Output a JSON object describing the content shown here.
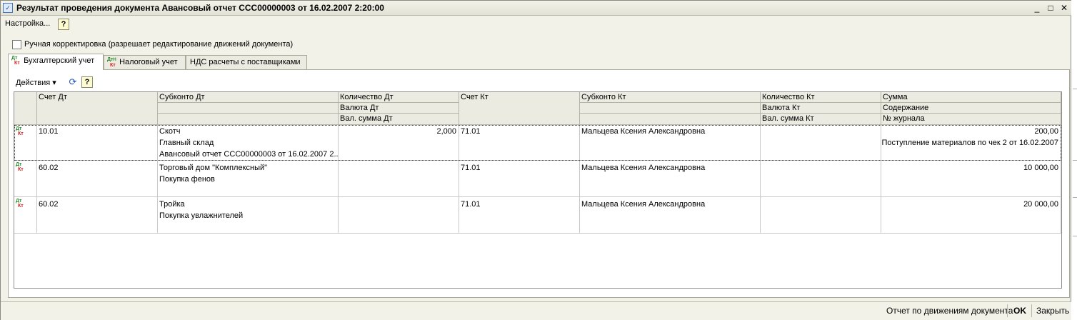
{
  "window": {
    "title": "Результат проведения документа Авансовый отчет ССС00000003 от 16.02.2007 2:20:00",
    "icon": "document-icon",
    "minimize": "_",
    "maximize": "□",
    "close": "✕"
  },
  "menu": {
    "settings": "Настройка...",
    "help": "?"
  },
  "manual_correction": {
    "label": "Ручная корректировка (разрешает редактирование движений документа)",
    "checked": false
  },
  "tabs": [
    {
      "label": "Бухгалтерский учет",
      "icon": "dt-kt-icon",
      "active": true
    },
    {
      "label": "Налоговый учет",
      "icon": "dt-kt-tax-icon",
      "active": false
    },
    {
      "label": "НДС расчеты с поставщиками",
      "icon": "",
      "active": false
    }
  ],
  "icon_text": {
    "dt": "Дт",
    "kt": "Кт",
    "n": "Н"
  },
  "toolbar": {
    "actions": "Действия ▾",
    "refresh": "⟳",
    "help": "?"
  },
  "table": {
    "headers": {
      "schet_dt": "Счет Дт",
      "subkonto_dt": "Субконто Дт",
      "kolvo_dt": "Количество Дт",
      "valuta_dt": "Валюта Дт",
      "val_summa_dt": "Вал. сумма Дт",
      "schet_kt": "Счет Кт",
      "subkonto_kt": "Субконто Кт",
      "kolvo_kt": "Количество Кт",
      "valuta_kt": "Валюта Кт",
      "val_summa_kt": "Вал. сумма Кт",
      "summa": "Сумма",
      "soderzhanie": "Содержание",
      "nomer_zhurnala": "№ журнала"
    },
    "rows": [
      {
        "schet_dt": "10.01",
        "subkonto_dt": [
          "Скотч",
          "Главный склад",
          "Авансовый отчет ССС00000003 от 16.02.2007 2..."
        ],
        "kolvo_dt": "2,000",
        "schet_kt": "71.01",
        "subkonto_kt": "Мальцева Ксения Александровна",
        "summa": "200,00",
        "soderzhanie": "Поступление материалов по чек 2 от 16.02.2007"
      },
      {
        "schet_dt": "60.02",
        "subkonto_dt": [
          "Торговый дом \"Комплексный\"",
          "Покупка фенов"
        ],
        "kolvo_dt": "",
        "schet_kt": "71.01",
        "subkonto_kt": "Мальцева Ксения Александровна",
        "summa": "10 000,00",
        "soderzhanie": ""
      },
      {
        "schet_dt": "60.02",
        "subkonto_dt": [
          "Тройка",
          "Покупка увлажнителей"
        ],
        "kolvo_dt": "",
        "schet_kt": "71.01",
        "subkonto_kt": "Мальцева Ксения Александровна",
        "summa": "20 000,00",
        "soderzhanie": ""
      }
    ]
  },
  "status": {
    "report": "Отчет по движениям документа",
    "ok": "OK",
    "close": "Закрыть"
  }
}
